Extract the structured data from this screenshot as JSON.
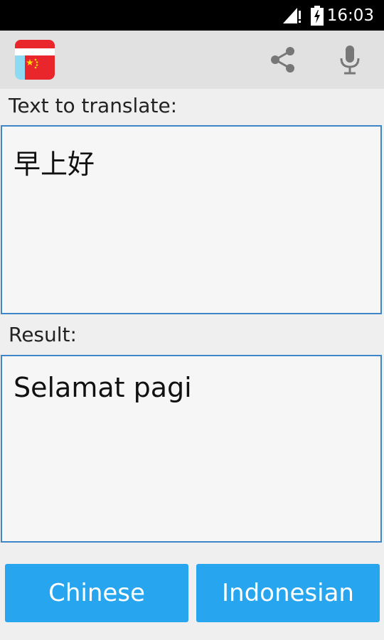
{
  "status_bar": {
    "time": "16:03",
    "icons": [
      "signal-icon",
      "battery-charging-icon"
    ]
  },
  "action_bar": {
    "app_icon": "id-cn-flags-icon",
    "actions": [
      "share-icon",
      "microphone-icon"
    ]
  },
  "source": {
    "label": "Text to translate:",
    "text": "早上好"
  },
  "result": {
    "label": "Result:",
    "text": "Selamat pagi"
  },
  "buttons": {
    "from_language": "Chinese",
    "to_language": "Indonesian"
  },
  "colors": {
    "accent": "#27a5ee",
    "border": "#3f86c8",
    "flag_red": "#e8262b",
    "flag_yellow": "#ffde00"
  }
}
